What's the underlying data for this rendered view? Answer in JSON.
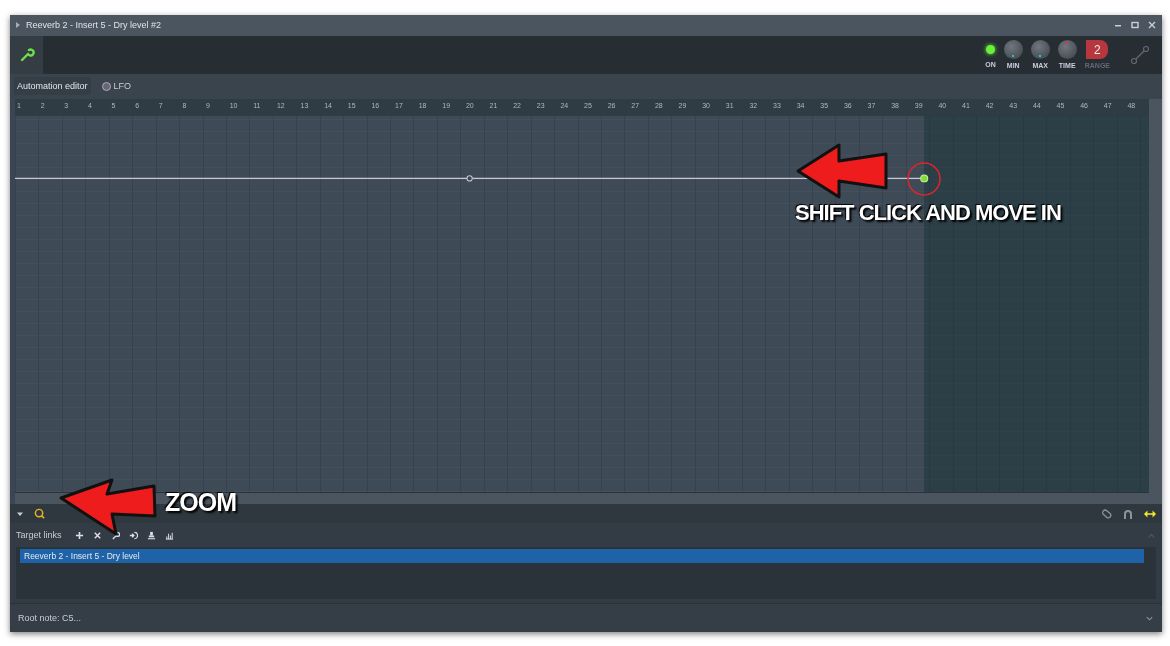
{
  "window": {
    "title": "Reeverb 2 - Insert 5 - Dry level #2"
  },
  "toolbar": {
    "on_led": {
      "label": "ON",
      "on": true
    },
    "knobs": [
      {
        "label": "MIN"
      },
      {
        "label": "MAX"
      },
      {
        "label": "TIME"
      }
    ],
    "range": {
      "label": "RANGE",
      "value": "2"
    }
  },
  "tabs": [
    {
      "label": "Automation editor",
      "selected": true
    },
    {
      "label": "LFO",
      "selected": false
    }
  ],
  "ruler": [
    "1",
    "2",
    "3",
    "4",
    "5",
    "6",
    "7",
    "8",
    "9",
    "10",
    "11",
    "12",
    "13",
    "14",
    "15",
    "16",
    "17",
    "18",
    "19",
    "20",
    "21",
    "22",
    "23",
    "24",
    "25",
    "26",
    "27",
    "28",
    "29",
    "30",
    "31",
    "32",
    "33",
    "34",
    "35",
    "36",
    "37",
    "38",
    "39",
    "40",
    "41",
    "42",
    "43",
    "44",
    "45",
    "46",
    "47",
    "48"
  ],
  "target_links": {
    "label": "Target links",
    "items": [
      {
        "label": "Reeverb 2 - Insert 5 - Dry level",
        "selected": true
      }
    ]
  },
  "root_note": "Root note: C5...",
  "annotations": [
    {
      "text": "SHIFT CLICK AND MOVE IN"
    },
    {
      "text": "ZOOM"
    }
  ]
}
